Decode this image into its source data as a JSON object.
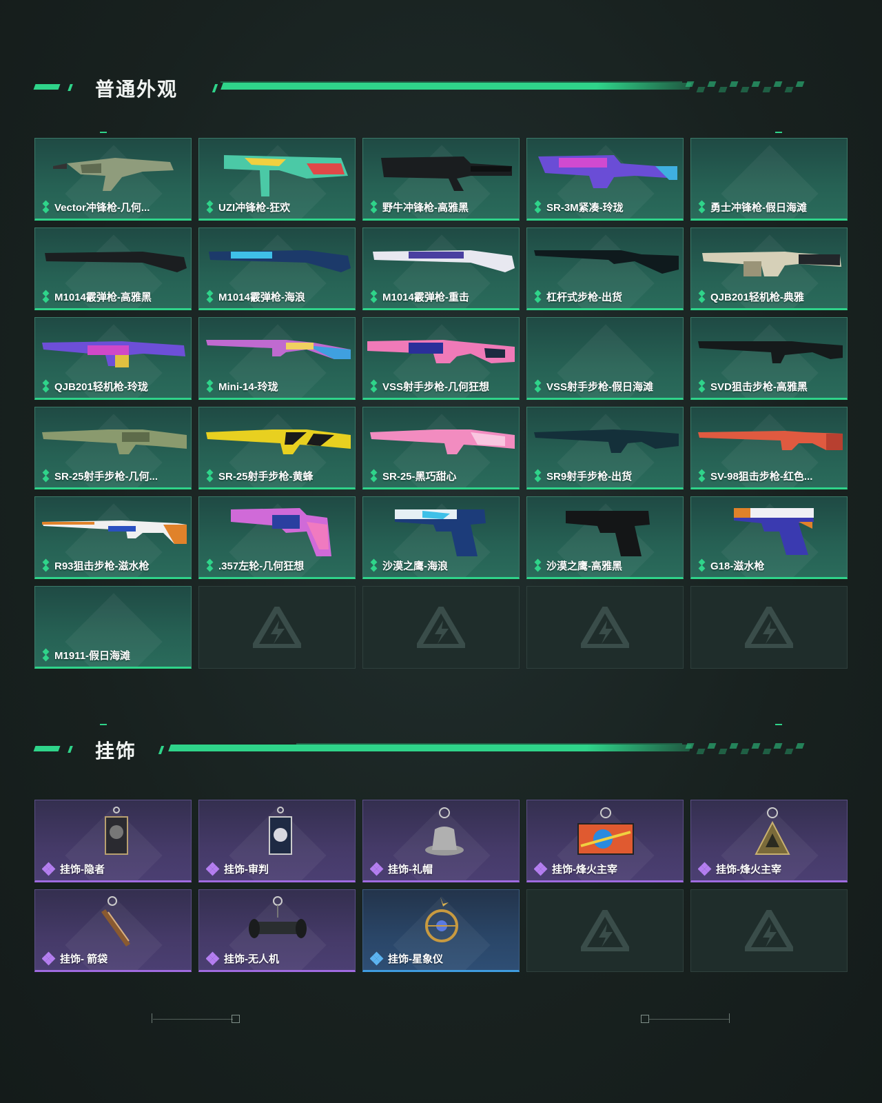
{
  "sections": {
    "skins": {
      "title": "普通外观",
      "items": [
        {
          "name": "Vector冲锋枪-几何..."
        },
        {
          "name": "UZI冲锋枪-狂欢"
        },
        {
          "name": "野牛冲锋枪-高雅黑"
        },
        {
          "name": "SR-3M紧凑-玲珑"
        },
        {
          "name": "勇士冲锋枪-假日海滩"
        },
        {
          "name": "M1014霰弹枪-高雅黑"
        },
        {
          "name": "M1014霰弹枪-海浪"
        },
        {
          "name": "M1014霰弹枪-重击"
        },
        {
          "name": "杠杆式步枪-出货"
        },
        {
          "name": "QJB201轻机枪-典雅"
        },
        {
          "name": "QJB201轻机枪-玲珑"
        },
        {
          "name": "Mini-14-玲珑"
        },
        {
          "name": "VSS射手步枪-几何狂想"
        },
        {
          "name": "VSS射手步枪-假日海滩"
        },
        {
          "name": "SVD狙击步枪-高雅黑"
        },
        {
          "name": "SR-25射手步枪-几何..."
        },
        {
          "name": "SR-25射手步枪-黄蜂"
        },
        {
          "name": "SR-25-黑巧甜心"
        },
        {
          "name": "SR9射手步枪-出货"
        },
        {
          "name": "SV-98狙击步枪-红色..."
        },
        {
          "name": "R93狙击步枪-滋水枪"
        },
        {
          "name": ".357左轮-几何狂想"
        },
        {
          "name": "沙漠之鹰-海浪"
        },
        {
          "name": "沙漠之鹰-高雅黑"
        },
        {
          "name": "G18-滋水枪"
        },
        {
          "name": "M1911-假日海滩"
        }
      ]
    },
    "charms": {
      "title": "挂饰",
      "items": [
        {
          "name": "挂饰-隐者"
        },
        {
          "name": "挂饰-审判"
        },
        {
          "name": "挂饰-礼帽"
        },
        {
          "name": "挂饰-烽火主宰"
        },
        {
          "name": "挂饰-烽火主宰"
        },
        {
          "name": "挂饰- 箭袋"
        },
        {
          "name": "挂饰-无人机"
        },
        {
          "name": "挂饰-星象仪"
        }
      ]
    }
  },
  "colors": {
    "accent": "#2fd48a",
    "purple_rarity": "#a06be0",
    "blue_rarity": "#3f9de0"
  }
}
